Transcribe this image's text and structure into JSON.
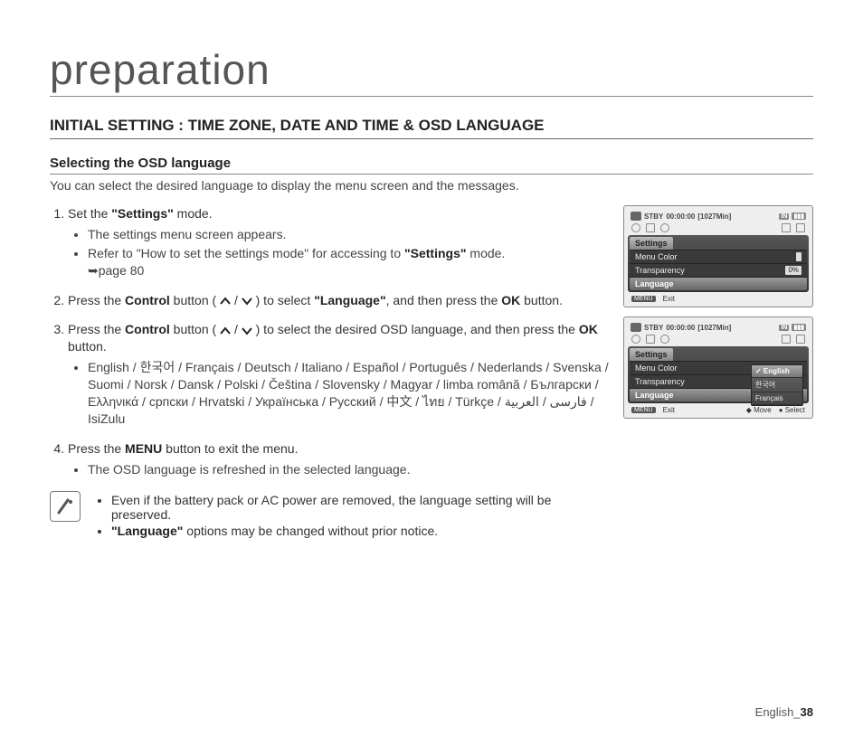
{
  "title": "preparation",
  "section_heading": "INITIAL SETTING : TIME ZONE, DATE AND TIME & OSD LANGUAGE",
  "sub_heading": "Selecting the OSD language",
  "intro": "You can select the desired language to display the menu screen and the messages.",
  "steps": {
    "s1_a": "Set the ",
    "s1_b": "\"Settings\"",
    "s1_c": " mode.",
    "s1_sub1": "The settings menu screen appears.",
    "s1_sub2_a": "Refer to \"How to set the settings mode\" for accessing to ",
    "s1_sub2_b": "\"Settings\"",
    "s1_sub2_c": " mode.",
    "s1_pageref": "➥page 80",
    "s2_a": "Press the ",
    "s2_b": "Control",
    "s2_c": " button ( ",
    "s2_d": " / ",
    "s2_e": " ) to select ",
    "s2_f": "\"Language\"",
    "s2_g": ", and then press the ",
    "s2_h": "OK",
    "s2_i": " button.",
    "s3_a": "Press the ",
    "s3_b": "Control",
    "s3_c": " button ( ",
    "s3_d": " / ",
    "s3_e": " ) to select the desired OSD language, and then press the ",
    "s3_f": "OK",
    "s3_g": " button.",
    "s3_langs": "English / 한국어 / Français / Deutsch / Italiano / Español / Português / Nederlands / Svenska / Suomi / Norsk / Dansk / Polski / Čeština / Slovensky / Magyar / limba română / Български / Ελληνικά / српски / Hrvatski / Українська / Русский / 中文 / ไทย / Türkçe / فارسی / العربية / IsiZulu",
    "s4_a": "Press the ",
    "s4_b": "MENU",
    "s4_c": " button to exit the menu.",
    "s4_sub1": "The OSD language is refreshed in the selected language."
  },
  "notes": {
    "n1": "Even if the battery pack or AC power are removed, the language setting will be preserved.",
    "n2_a": "\"Language\"",
    "n2_b": " options may be changed without prior notice."
  },
  "footer": {
    "lang": "English",
    "page": "38"
  },
  "osd": {
    "stby": "STBY",
    "time": "00:00:00",
    "remain": "[1027Min]",
    "tab": "Settings",
    "row1": "Menu Color",
    "row2": "Transparency",
    "row3": "Language",
    "val_blank": "",
    "val_pct": "0%",
    "menu": "MENU",
    "exit": "Exit",
    "move": "Move",
    "select": "Select",
    "popup": {
      "english": "✓ English",
      "korean": "한국어",
      "french": "Français"
    }
  }
}
